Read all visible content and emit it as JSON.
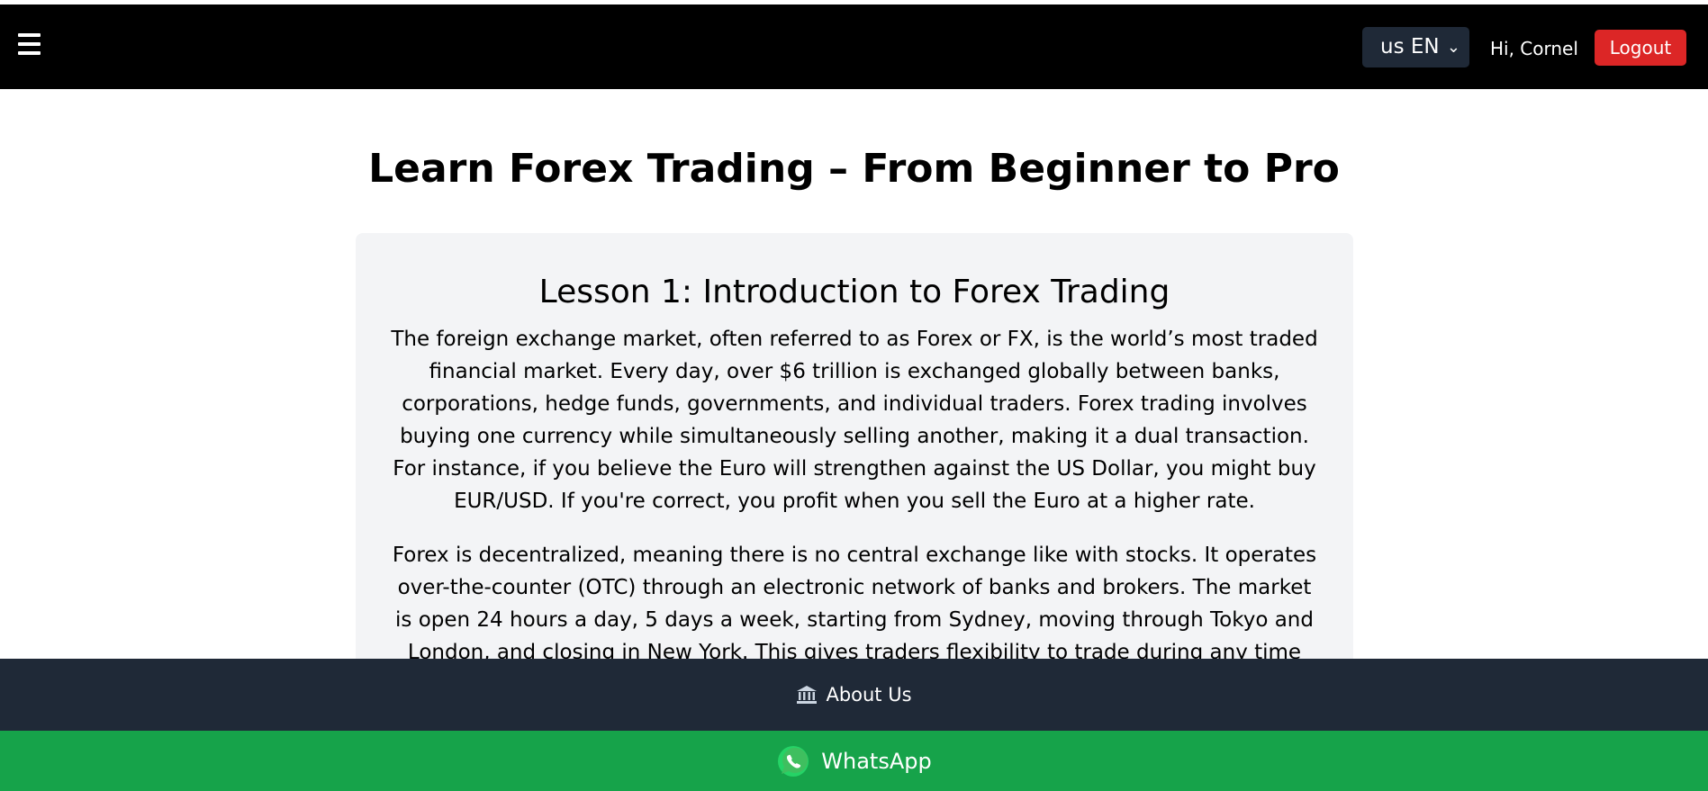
{
  "navbar": {
    "menu_icon": "hamburger-menu-icon",
    "language": {
      "flag_text": "us",
      "selected": "EN"
    },
    "greeting": "Hi, Cornel",
    "logout_label": "Logout"
  },
  "main": {
    "title": "Learn Forex Trading – From Beginner to Pro",
    "lesson": {
      "title": "Lesson 1: Introduction to Forex Trading",
      "paragraphs": [
        "The foreign exchange market, often referred to as Forex or FX, is the world’s most traded financial market. Every day, over $6 trillion is exchanged globally between banks, corporations, hedge funds, governments, and individual traders. Forex trading involves buying one currency while simultaneously selling another, making it a dual transaction. For instance, if you believe the Euro will strengthen against the US Dollar, you might buy EUR/USD. If you're correct, you profit when you sell the Euro at a higher rate.",
        "Forex is decentralized, meaning there is no central exchange like with stocks. It operates over-the-counter (OTC) through an electronic network of banks and brokers. The market is open 24 hours a day, 5 days a week, starting from Sydney, moving through Tokyo and London, and closing in New York. This gives traders flexibility to trade during any time zone that suits them."
      ]
    }
  },
  "footer": {
    "about_label": "About Us",
    "about_icon": "bank-icon",
    "whatsapp_label": "WhatsApp",
    "whatsapp_icon": "whatsapp-icon"
  },
  "colors": {
    "navbar_bg": "#000000",
    "logout_bg": "#dc2626",
    "card_bg": "#f3f4f6",
    "about_bg": "#1f2937",
    "whatsapp_bg": "#16a34a"
  }
}
